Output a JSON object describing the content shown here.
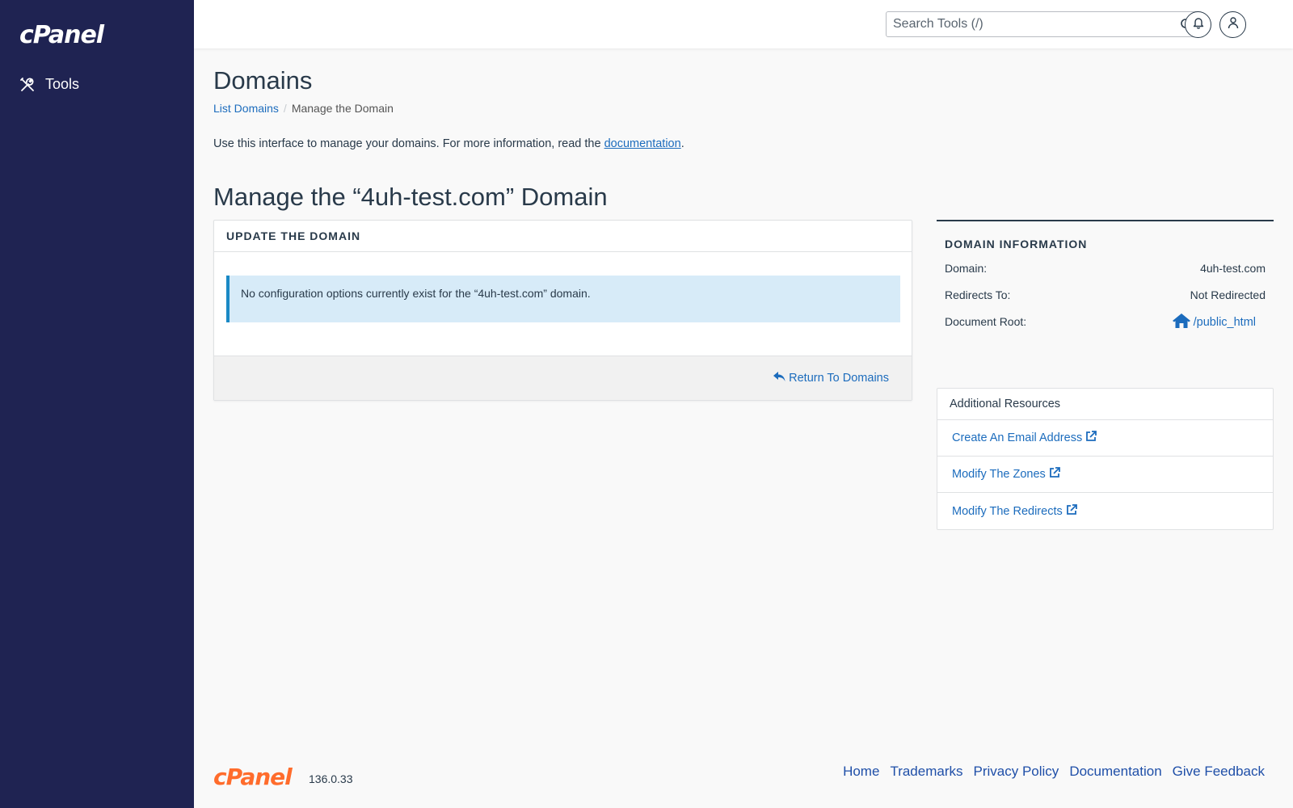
{
  "brand": {
    "logo_text": "cPanel"
  },
  "sidebar": {
    "items": [
      {
        "label": "Tools",
        "icon": "tools-icon"
      }
    ]
  },
  "header": {
    "search_placeholder": "Search Tools (/)",
    "search_icon": "search-icon",
    "notifications_icon": "bell-icon",
    "user_icon": "user-icon"
  },
  "page": {
    "title": "Domains",
    "breadcrumb": {
      "link": "List Domains",
      "current": "Manage the Domain"
    },
    "intro_text": "Use this interface to manage your domains. For more information, read the ",
    "intro_link": "documentation",
    "intro_end": ".",
    "section_title": "Manage the “4uh-test.com” Domain"
  },
  "update_panel": {
    "heading": "UPDATE THE DOMAIN",
    "alert_text": "No configuration options currently exist for the “4uh-test.com” domain.",
    "return_label": "Return To Domains"
  },
  "domain_info": {
    "heading": "DOMAIN INFORMATION",
    "domain_label": "Domain:",
    "domain_value": "4uh-test.com",
    "redirects_label": "Redirects To:",
    "redirects_value": "Not Redirected",
    "docroot_label": "Document Root:",
    "docroot_value": "/public_html"
  },
  "resources": {
    "heading": "Additional Resources",
    "items": [
      {
        "label": "Create An Email Address"
      },
      {
        "label": "Modify The Zones"
      },
      {
        "label": "Modify The Redirects"
      }
    ]
  },
  "footer": {
    "logo_text": "cPanel",
    "version": "136.0.33",
    "links": [
      "Home",
      "Trademarks",
      "Privacy Policy",
      "Documentation",
      "Give Feedback"
    ]
  },
  "colors": {
    "sidebar": "#1f2352",
    "link": "#1c6cbd",
    "accent_orange": "#ff6c2c",
    "alert_bg": "#d7ebf8",
    "alert_border": "#1a89c5"
  }
}
